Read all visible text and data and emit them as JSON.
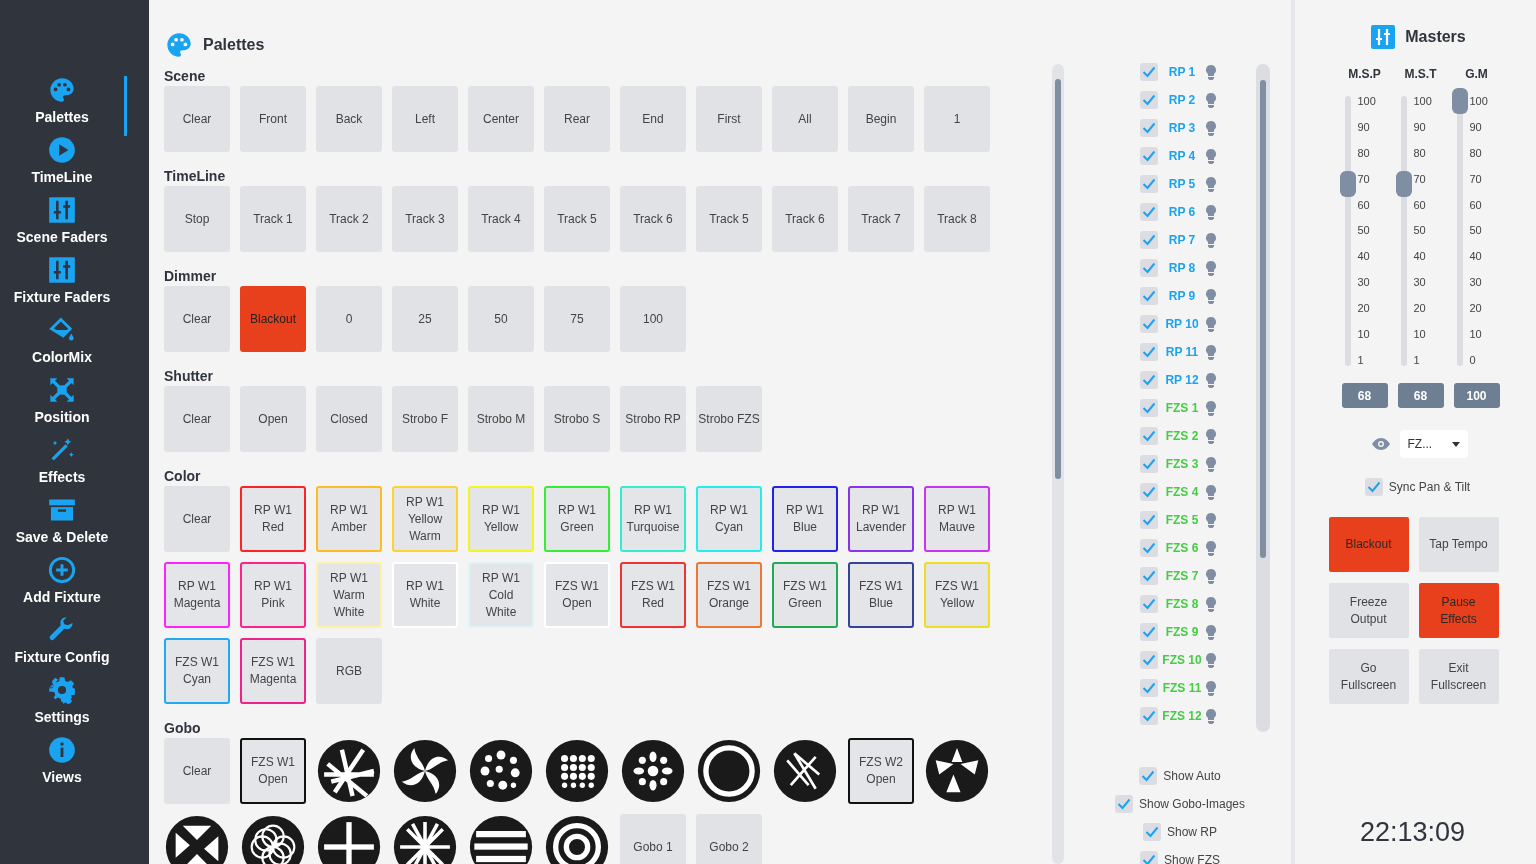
{
  "sidebar": {
    "items": [
      {
        "label": "Palettes",
        "selected": true
      },
      {
        "label": "TimeLine",
        "selected": false
      },
      {
        "label": "Scene Faders",
        "selected": false
      },
      {
        "label": "Fixture Faders",
        "selected": false
      },
      {
        "label": "ColorMix",
        "selected": false
      },
      {
        "label": "Position",
        "selected": false
      },
      {
        "label": "Effects",
        "selected": false
      },
      {
        "label": "Save & Delete",
        "selected": false
      },
      {
        "label": "Add Fixture",
        "selected": false
      },
      {
        "label": "Fixture Config",
        "selected": false
      },
      {
        "label": "Settings",
        "selected": false
      },
      {
        "label": "Views",
        "selected": false
      }
    ]
  },
  "palettes": {
    "title": "Palettes",
    "sections": [
      {
        "title": "Scene",
        "buttons": [
          {
            "kind": "text",
            "label": "Clear"
          },
          {
            "kind": "text",
            "label": "Front"
          },
          {
            "kind": "text",
            "label": "Back"
          },
          {
            "kind": "text",
            "label": "Left"
          },
          {
            "kind": "text",
            "label": "Center"
          },
          {
            "kind": "text",
            "label": "Rear"
          },
          {
            "kind": "text",
            "label": "End"
          },
          {
            "kind": "text",
            "label": "First"
          },
          {
            "kind": "text",
            "label": "All"
          },
          {
            "kind": "text",
            "label": "Begin"
          },
          {
            "kind": "text",
            "label": "1"
          }
        ]
      },
      {
        "title": "TimeLine",
        "buttons": [
          {
            "kind": "text",
            "label": "Stop"
          },
          {
            "kind": "text",
            "label": "Track 1"
          },
          {
            "kind": "text",
            "label": "Track 2"
          },
          {
            "kind": "text",
            "label": "Track 3"
          },
          {
            "kind": "text",
            "label": "Track 4"
          },
          {
            "kind": "text",
            "label": "Track 5"
          },
          {
            "kind": "text",
            "label": "Track 6"
          },
          {
            "kind": "text",
            "label": "Track 5"
          },
          {
            "kind": "text",
            "label": "Track 6"
          },
          {
            "kind": "text",
            "label": "Track 7"
          },
          {
            "kind": "text",
            "label": "Track 8"
          }
        ]
      },
      {
        "title": "Dimmer",
        "buttons": [
          {
            "kind": "text",
            "label": "Clear"
          },
          {
            "kind": "text",
            "label": "Blackout",
            "on": true
          },
          {
            "kind": "text",
            "label": "0"
          },
          {
            "kind": "text",
            "label": "25"
          },
          {
            "kind": "text",
            "label": "50"
          },
          {
            "kind": "text",
            "label": "75"
          },
          {
            "kind": "text",
            "label": "100"
          }
        ]
      },
      {
        "title": "Shutter",
        "buttons": [
          {
            "kind": "text",
            "label": "Clear"
          },
          {
            "kind": "text",
            "label": "Open"
          },
          {
            "kind": "text",
            "label": "Closed"
          },
          {
            "kind": "text",
            "label": "Strobo F"
          },
          {
            "kind": "text",
            "label": "Strobo M"
          },
          {
            "kind": "text",
            "label": "Strobo S"
          },
          {
            "kind": "text",
            "label": "Strobo RP"
          },
          {
            "kind": "text",
            "label": "Strobo FZS"
          }
        ]
      },
      {
        "title": "Color",
        "buttons": [
          {
            "kind": "text",
            "label": "Clear"
          },
          {
            "kind": "outlined",
            "label": "RP W1 Red",
            "color": "#ff2222"
          },
          {
            "kind": "outlined",
            "label": "RP W1 Amber",
            "color": "#ffbb22"
          },
          {
            "kind": "outlined",
            "label": "RP W1 Yellow Warm",
            "color": "#ffd22e"
          },
          {
            "kind": "outlined",
            "label": "RP W1 Yellow",
            "color": "#f5f51e"
          },
          {
            "kind": "outlined",
            "label": "RP W1 Green",
            "color": "#33ee33"
          },
          {
            "kind": "outlined",
            "label": "RP W1 Turquoise",
            "color": "#33eecc"
          },
          {
            "kind": "outlined",
            "label": "RP W1 Cyan",
            "color": "#22eeee"
          },
          {
            "kind": "outlined",
            "label": "RP W1 Blue",
            "color": "#2222ee"
          },
          {
            "kind": "outlined",
            "label": "RP W1 Lavender",
            "color": "#8833ee"
          },
          {
            "kind": "outlined",
            "label": "RP W1 Mauve",
            "color": "#cc33ee"
          },
          {
            "kind": "outlined",
            "label": "RP W1 Magenta",
            "color": "#ff22ff"
          },
          {
            "kind": "outlined",
            "label": "RP W1 Pink",
            "color": "#ff2288"
          },
          {
            "kind": "outlined",
            "label": "RP W1 Warm White",
            "color": "#fff0aa"
          },
          {
            "kind": "outlined",
            "label": "RP W1 White",
            "color": "#ffffff"
          },
          {
            "kind": "outlined",
            "label": "RP W1 Cold White",
            "color": "#ddf5f8"
          },
          {
            "kind": "outlined",
            "label": "FZS W1 Open",
            "color": "#ffffff"
          },
          {
            "kind": "outlined",
            "label": "FZS W1 Red",
            "color": "#ee3333"
          },
          {
            "kind": "outlined",
            "label": "FZS W1 Orange",
            "color": "#ee7733"
          },
          {
            "kind": "outlined",
            "label": "FZS W1 Green",
            "color": "#22aa55"
          },
          {
            "kind": "outlined",
            "label": "FZS W1 Blue",
            "color": "#334499"
          },
          {
            "kind": "outlined",
            "label": "FZS W1 Yellow",
            "color": "#eedd22"
          },
          {
            "kind": "outlined",
            "label": "FZS W1 Cyan",
            "color": "#22aaee"
          },
          {
            "kind": "outlined",
            "label": "FZS W1 Magenta",
            "color": "#ee2288"
          },
          {
            "kind": "text",
            "label": "RGB"
          }
        ]
      },
      {
        "title": "Gobo",
        "buttons": [
          {
            "kind": "text",
            "label": "Clear"
          },
          {
            "kind": "outlined",
            "label": "FZS W1 Open",
            "color": "#111111"
          },
          {
            "kind": "image"
          },
          {
            "kind": "image"
          },
          {
            "kind": "image"
          },
          {
            "kind": "image"
          },
          {
            "kind": "image"
          },
          {
            "kind": "image"
          },
          {
            "kind": "image"
          },
          {
            "kind": "outlined",
            "label": "FZS W2 Open",
            "color": "#111111"
          },
          {
            "kind": "image"
          },
          {
            "kind": "image"
          },
          {
            "kind": "image"
          },
          {
            "kind": "image"
          },
          {
            "kind": "image"
          },
          {
            "kind": "image"
          },
          {
            "kind": "image"
          },
          {
            "kind": "text",
            "label": "Gobo 1"
          },
          {
            "kind": "text",
            "label": "Gobo 2"
          }
        ]
      }
    ]
  },
  "fixtures": [
    {
      "label": "RP 1",
      "checked": true,
      "color": "#1aa3f0"
    },
    {
      "label": "RP 2",
      "checked": true,
      "color": "#1aa3f0"
    },
    {
      "label": "RP 3",
      "checked": true,
      "color": "#1aa3f0"
    },
    {
      "label": "RP 4",
      "checked": true,
      "color": "#1aa3f0"
    },
    {
      "label": "RP 5",
      "checked": true,
      "color": "#1aa3f0"
    },
    {
      "label": "RP 6",
      "checked": true,
      "color": "#1aa3f0"
    },
    {
      "label": "RP 7",
      "checked": true,
      "color": "#1aa3f0"
    },
    {
      "label": "RP 8",
      "checked": true,
      "color": "#1aa3f0"
    },
    {
      "label": "RP 9",
      "checked": true,
      "color": "#1aa3f0"
    },
    {
      "label": "RP 10",
      "checked": true,
      "color": "#1aa3f0"
    },
    {
      "label": "RP 11",
      "checked": true,
      "color": "#1aa3f0"
    },
    {
      "label": "RP 12",
      "checked": true,
      "color": "#1aa3f0"
    },
    {
      "label": "FZS 1",
      "checked": true,
      "color": "#44cc44"
    },
    {
      "label": "FZS 2",
      "checked": true,
      "color": "#44cc44"
    },
    {
      "label": "FZS 3",
      "checked": true,
      "color": "#44cc44"
    },
    {
      "label": "FZS 4",
      "checked": true,
      "color": "#44cc44"
    },
    {
      "label": "FZS 5",
      "checked": true,
      "color": "#44cc44"
    },
    {
      "label": "FZS 6",
      "checked": true,
      "color": "#44cc44"
    },
    {
      "label": "FZS 7",
      "checked": true,
      "color": "#44cc44"
    },
    {
      "label": "FZS 8",
      "checked": true,
      "color": "#44cc44"
    },
    {
      "label": "FZS 9",
      "checked": true,
      "color": "#44cc44"
    },
    {
      "label": "FZS 10",
      "checked": true,
      "color": "#44cc44"
    },
    {
      "label": "FZS 11",
      "checked": true,
      "color": "#44cc44"
    },
    {
      "label": "FZS 12",
      "checked": true,
      "color": "#44cc44"
    }
  ],
  "options": [
    {
      "label": "Show Auto",
      "checked": true
    },
    {
      "label": "Show Gobo-Images",
      "checked": true
    },
    {
      "label": "Show RP",
      "checked": true
    },
    {
      "label": "Show FZS",
      "checked": true
    }
  ],
  "masters": {
    "title": "Masters",
    "faders": [
      {
        "label": "M.S.P",
        "level": 0.68,
        "ticks": [
          "100",
          "90",
          "80",
          "70",
          "60",
          "50",
          "40",
          "30",
          "20",
          "10",
          "1"
        ],
        "value": "68"
      },
      {
        "label": "M.S.T",
        "level": 0.68,
        "ticks": [
          "100",
          "90",
          "80",
          "70",
          "60",
          "50",
          "40",
          "30",
          "20",
          "10",
          "1"
        ],
        "value": "68"
      },
      {
        "label": "G.M",
        "level": 1,
        "ticks": [
          "100",
          "90",
          "80",
          "70",
          "60",
          "50",
          "40",
          "30",
          "20",
          "10",
          "0"
        ],
        "value": "100"
      }
    ],
    "dropdown": {
      "value": "FZ..."
    },
    "sync": {
      "label": "Sync Pan & Tilt",
      "checked": true
    },
    "buttons": [
      {
        "label": "Blackout",
        "on": true
      },
      {
        "label": "Tap Tempo",
        "on": false
      },
      {
        "label": "Freeze Output",
        "on": false
      },
      {
        "label": "Pause Effects",
        "on": true
      },
      {
        "label": "Go Fullscreen",
        "on": false
      },
      {
        "label": "Exit Fullscreen",
        "on": false
      }
    ],
    "clock": "22:13:09"
  }
}
